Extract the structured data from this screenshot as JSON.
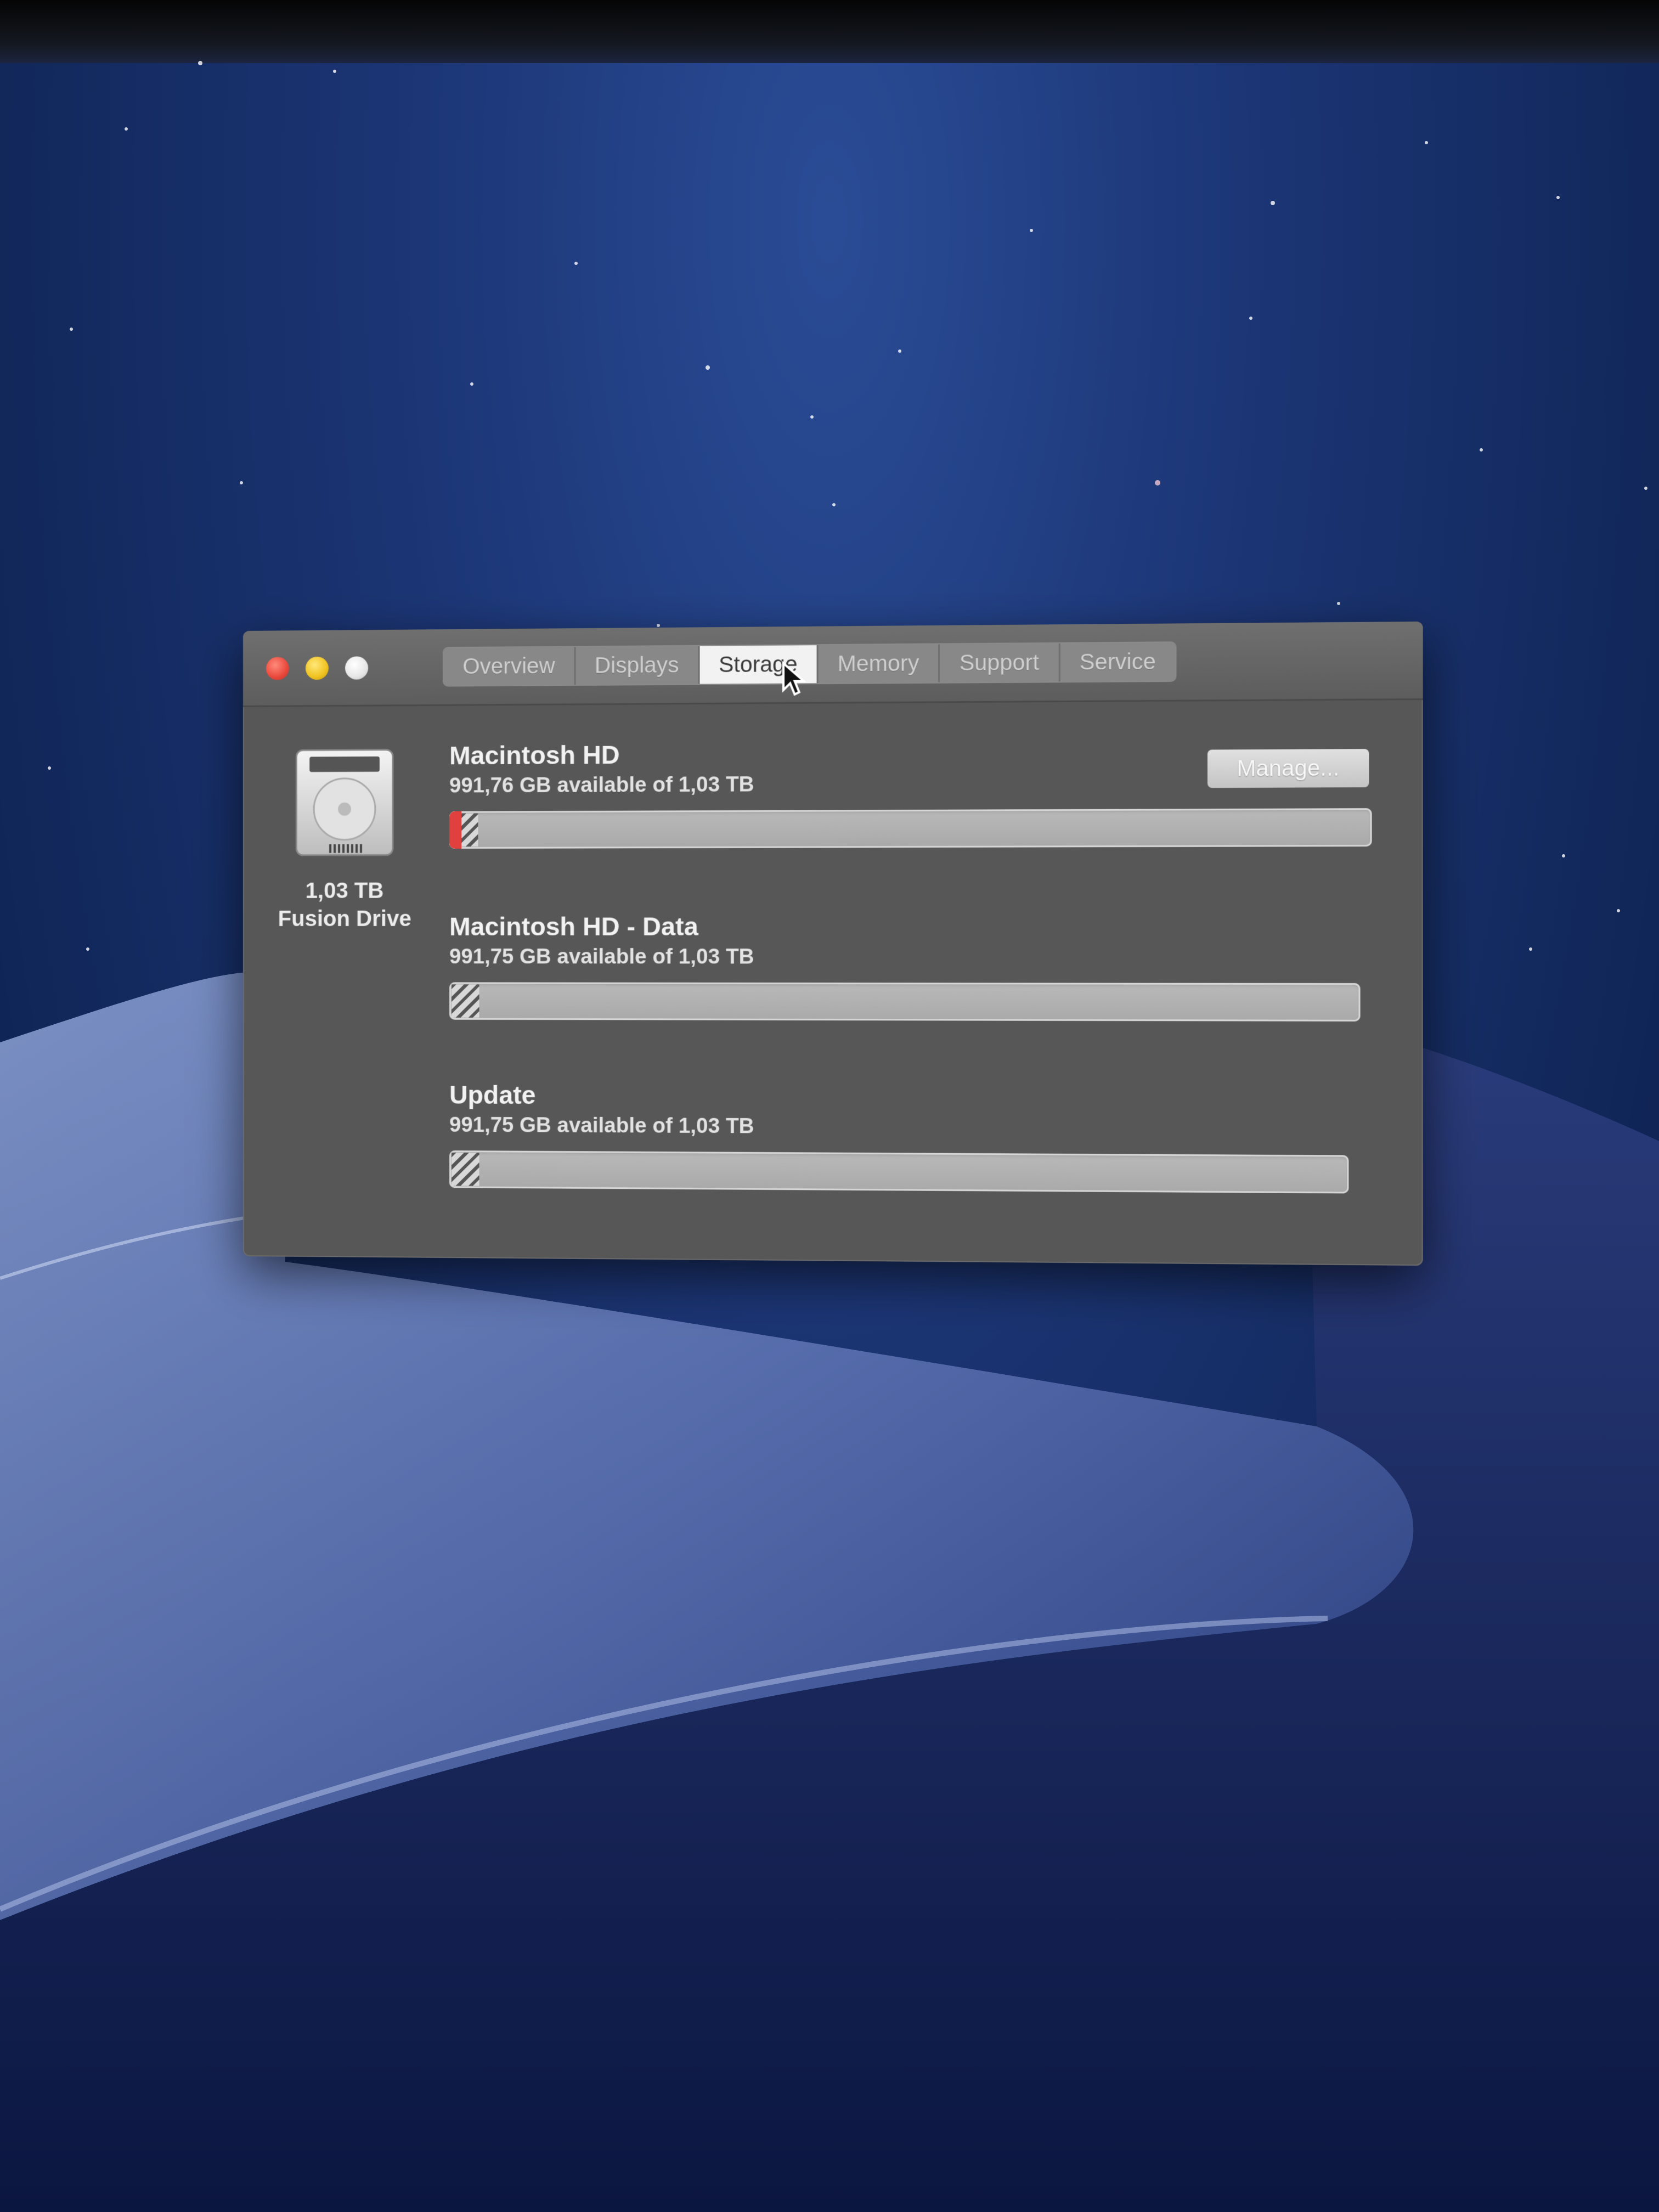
{
  "window": {
    "tabs": [
      {
        "label": "Overview",
        "active": false
      },
      {
        "label": "Displays",
        "active": false
      },
      {
        "label": "Storage",
        "active": true
      },
      {
        "label": "Memory",
        "active": false
      },
      {
        "label": "Support",
        "active": false
      },
      {
        "label": "Service",
        "active": false
      }
    ]
  },
  "drive": {
    "icon": "hard-drive-icon",
    "size": "1,03 TB",
    "type": "Fusion Drive"
  },
  "manage_button": "Manage...",
  "volumes": [
    {
      "name": "Macintosh HD",
      "availability": "991,76 GB available of 1,03 TB",
      "used_fraction": 0.035
    },
    {
      "name": "Macintosh HD - Data",
      "availability": "991,75 GB available of 1,03 TB",
      "used_fraction": 0.035
    },
    {
      "name": "Update",
      "availability": "991,75 GB available of 1,03 TB",
      "used_fraction": 0.035
    }
  ],
  "colors": {
    "used_system": "#e0403e",
    "window_bg": "#575757",
    "close": "#e9483b",
    "minimize": "#f0c21f",
    "zoom": "#e6e6e6"
  }
}
